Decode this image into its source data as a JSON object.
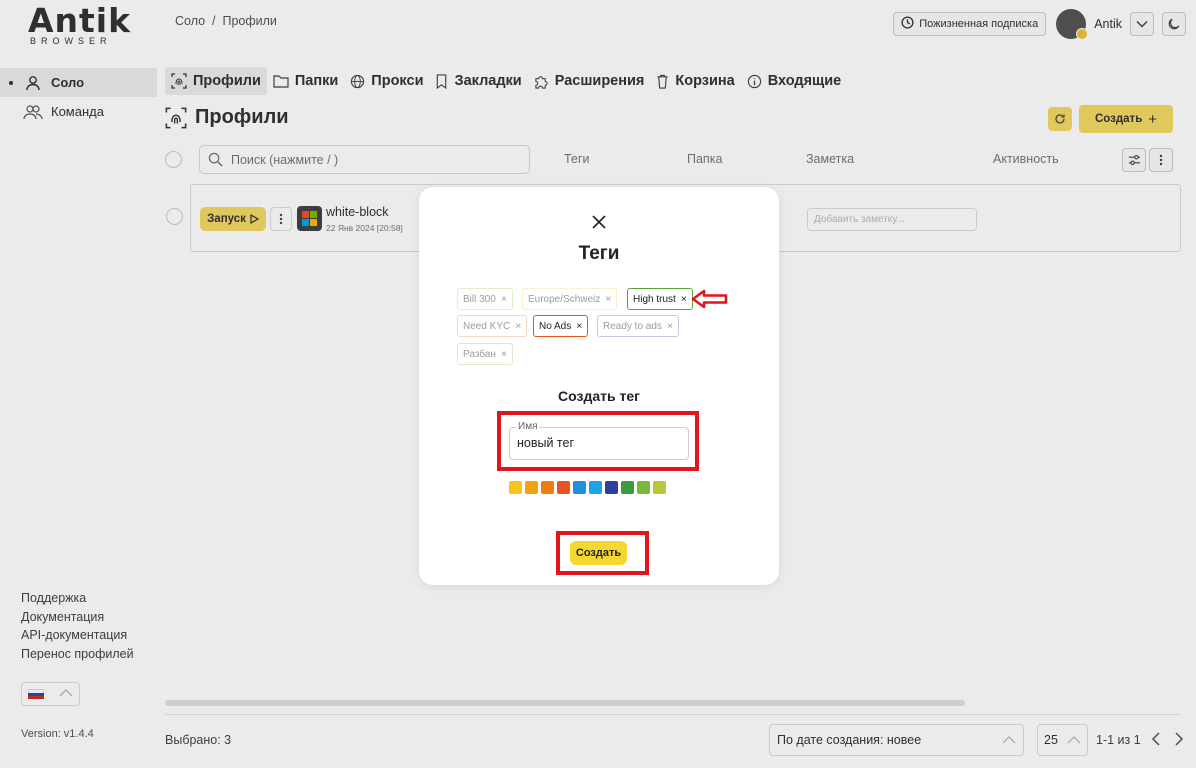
{
  "app": {
    "logo_main": "Antik",
    "logo_sub": "BROWSER",
    "breadcrumb": "Соло  /  Профили",
    "subscription": "Пожизненная подписка",
    "user_name": "Antik"
  },
  "sidebar": {
    "items": [
      {
        "label": "Соло",
        "active": true,
        "icon": "user-icon"
      },
      {
        "label": "Команда",
        "active": false,
        "icon": "team-icon"
      }
    ],
    "links": [
      "Поддержка",
      "Документация",
      "API-документация",
      "Перенос профилей"
    ],
    "version": "Version: v1.4.4",
    "language_flag": "ru-flag-icon"
  },
  "tabs": [
    {
      "label": "Профили",
      "icon": "fingerprint-icon",
      "active": true
    },
    {
      "label": "Папки",
      "icon": "folder-icon",
      "active": false
    },
    {
      "label": "Прокси",
      "icon": "globe-icon",
      "active": false
    },
    {
      "label": "Закладки",
      "icon": "bookmark-icon",
      "active": false
    },
    {
      "label": "Расширения",
      "icon": "puzzle-icon",
      "active": false
    },
    {
      "label": "Корзина",
      "icon": "trash-icon",
      "active": false
    },
    {
      "label": "Входящие",
      "icon": "info-icon",
      "active": false
    }
  ],
  "page": {
    "title": "Профили",
    "create_label": "Создать",
    "create_plus": "+",
    "search_placeholder": "Поиск (нажмите / )",
    "columns": [
      "Теги",
      "Папка",
      "Заметка",
      "Активность"
    ]
  },
  "profiles": [
    {
      "name": "white-block",
      "date": "22 Янв 2024 [20:58]",
      "run_label": "Запуск",
      "note_placeholder": "Добавить заметку..."
    }
  ],
  "footer": {
    "selected": "Выбрано: 3",
    "sort": "По дате создания: новее",
    "page_size": "25",
    "pages": "1-1 из 1"
  },
  "modal": {
    "title": "Теги",
    "tags": [
      {
        "label": "Bill 300",
        "color": "#b9d98a",
        "dim": true
      },
      {
        "label": "Europe/Schweiz",
        "color": "#f2df8a",
        "dim": true
      },
      {
        "label": "High trust",
        "color": "#55a23a",
        "dim": false
      },
      {
        "label": "Need KYC",
        "color": "#f0a38a",
        "dim": true
      },
      {
        "label": "No Ads",
        "color": "#e2541a",
        "dim": false
      },
      {
        "label": "Ready to ads",
        "color": "#7b86d6",
        "dim": true
      },
      {
        "label": "Разбан",
        "color": "#a6d690",
        "dim": true
      }
    ],
    "remove_glyph": "×",
    "create_title": "Создать тег",
    "name_label": "Имя",
    "name_value": "новый тег",
    "colors": [
      "#f5c518",
      "#f2a30f",
      "#ef7d12",
      "#e65420",
      "#1f8fe0",
      "#1aa3e8",
      "#2e3f9e",
      "#3c9b3c",
      "#79b83a",
      "#b8c83a"
    ],
    "create_button": "Создать"
  }
}
